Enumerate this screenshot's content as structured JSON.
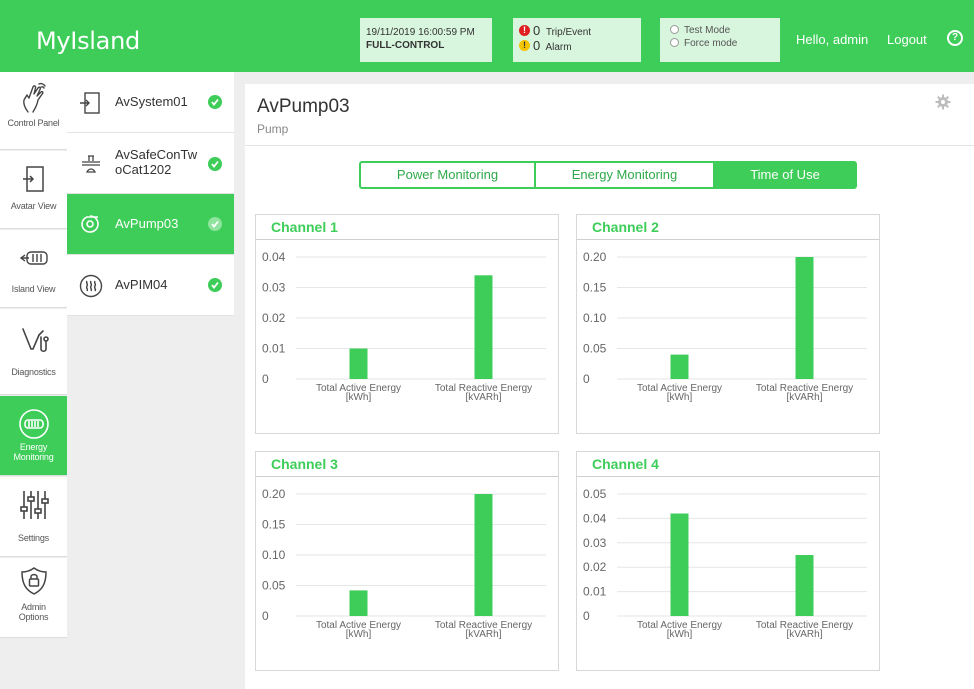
{
  "header": {
    "app_title": "MyIsland",
    "datetime": "19/11/2019 16:00:59 PM",
    "control_mode": "FULL-CONTROL",
    "trip_count": "0",
    "trip_label": "Trip/Event",
    "alarm_count": "0",
    "alarm_label": "Alarm",
    "mode_test": "Test Mode",
    "mode_force": "Force mode",
    "greeting": "Hello, admin",
    "logout": "Logout",
    "help": "?"
  },
  "nav": [
    {
      "label": "Control Panel",
      "icon": "hand-touch-icon"
    },
    {
      "label": "Avatar View",
      "icon": "avatar-icon"
    },
    {
      "label": "Island View",
      "icon": "island-icon"
    },
    {
      "label": "Diagnostics",
      "icon": "stethoscope-icon"
    },
    {
      "label": "Energy Monitoring",
      "icon": "energy-meter-icon"
    },
    {
      "label": "Settings",
      "icon": "sliders-icon"
    },
    {
      "label": "Admin Options",
      "icon": "shield-lock-icon"
    }
  ],
  "devices": [
    {
      "name": "AvSystem01",
      "icon": "avatar-icon",
      "status": "ok"
    },
    {
      "name": "AvSafeConTwoCat1202",
      "line1": "AvSafeConTw",
      "line2": "oCat1202",
      "icon": "conveyor-icon",
      "status": "ok"
    },
    {
      "name": "AvPump03",
      "icon": "pump-icon",
      "status": "ok"
    },
    {
      "name": "AvPIM04",
      "icon": "heater-icon",
      "status": "ok"
    }
  ],
  "page": {
    "title": "AvPump03",
    "subtitle": "Pump"
  },
  "tabs": [
    "Power Monitoring",
    "Energy Monitoring",
    "Time of Use"
  ],
  "colors": {
    "accent": "#3dcd58",
    "bar": "#3dcd58"
  },
  "chart_data": [
    {
      "type": "bar",
      "title": "Channel 1",
      "categories": [
        "Total Active Energy\n[kWh]",
        "Total Reactive Energy\n[kVARh]"
      ],
      "values": [
        0.01,
        0.034
      ],
      "ylim": [
        0,
        0.04
      ],
      "yticks": [
        "0",
        "0.01",
        "0.02",
        "0.03",
        "0.04"
      ],
      "grid": true
    },
    {
      "type": "bar",
      "title": "Channel 2",
      "categories": [
        "Total Active Energy\n[kWh]",
        "Total Reactive Energy\n[kVARh]"
      ],
      "values": [
        0.04,
        0.2
      ],
      "ylim": [
        0,
        0.2
      ],
      "yticks": [
        "0",
        "0.05",
        "0.10",
        "0.15",
        "0.20"
      ],
      "grid": true
    },
    {
      "type": "bar",
      "title": "Channel 3",
      "categories": [
        "Total Active Energy\n[kWh]",
        "Total Reactive Energy\n[kVARh]"
      ],
      "values": [
        0.042,
        0.2
      ],
      "ylim": [
        0,
        0.2
      ],
      "yticks": [
        "0",
        "0.05",
        "0.10",
        "0.15",
        "0.20"
      ],
      "grid": true
    },
    {
      "type": "bar",
      "title": "Channel 4",
      "categories": [
        "Total Active Energy\n[kWh]",
        "Total Reactive Energy\n[kVARh]"
      ],
      "values": [
        0.042,
        0.025
      ],
      "ylim": [
        0,
        0.05
      ],
      "yticks": [
        "0",
        "0.01",
        "0.02",
        "0.03",
        "0.04",
        "0.05"
      ],
      "grid": true
    }
  ]
}
